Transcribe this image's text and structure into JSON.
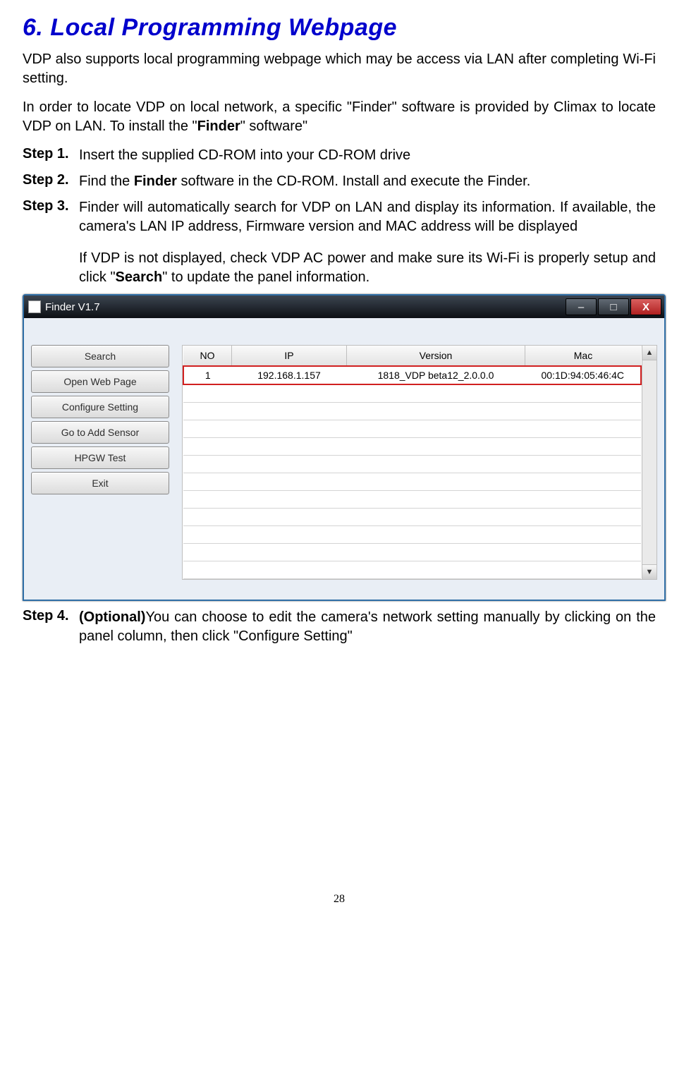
{
  "heading": "6. Local Programming Webpage",
  "para1": "VDP also supports local programming webpage which may be access via LAN after completing Wi-Fi setting.",
  "para2_pre": "In order to locate VDP on local network, a specific \"Finder\" software is provided by Climax to locate VDP on LAN. To install the \"",
  "para2_bold": "Finder",
  "para2_post": "\" software\"",
  "steps": {
    "s1": {
      "label": "Step 1.",
      "text": "Insert the supplied CD-ROM into your CD-ROM drive"
    },
    "s2": {
      "label": "Step 2.",
      "pre": "Find the ",
      "bold": "Finder",
      "post": " software in the CD-ROM. Install and execute the Finder."
    },
    "s3": {
      "label": "Step 3.",
      "text": "Finder will automatically search for VDP on LAN and display its information. If available, the camera's LAN IP address, Firmware version and MAC address will be displayed",
      "sub_pre": "If VDP is not displayed, check VDP AC power and make sure its Wi-Fi is properly setup and click \"",
      "sub_bold": "Search",
      "sub_post": "\" to update the panel information."
    },
    "s4": {
      "label": "Step 4.",
      "bold": "(Optional)",
      "post": "You can choose to edit the camera's network setting manually by clicking on the panel column, then click \"Configure Setting\""
    }
  },
  "window": {
    "title": "Finder V1.7",
    "buttons": [
      "Search",
      "Open Web Page",
      "Configure Setting",
      "Go to Add Sensor",
      "HPGW Test",
      "Exit"
    ],
    "columns": [
      "NO",
      "IP",
      "Version",
      "Mac"
    ],
    "row": {
      "no": "1",
      "ip": "192.168.1.157",
      "version": "1818_VDP   beta12_2.0.0.0",
      "mac": "00:1D:94:05:46:4C"
    }
  },
  "page_number": "28"
}
